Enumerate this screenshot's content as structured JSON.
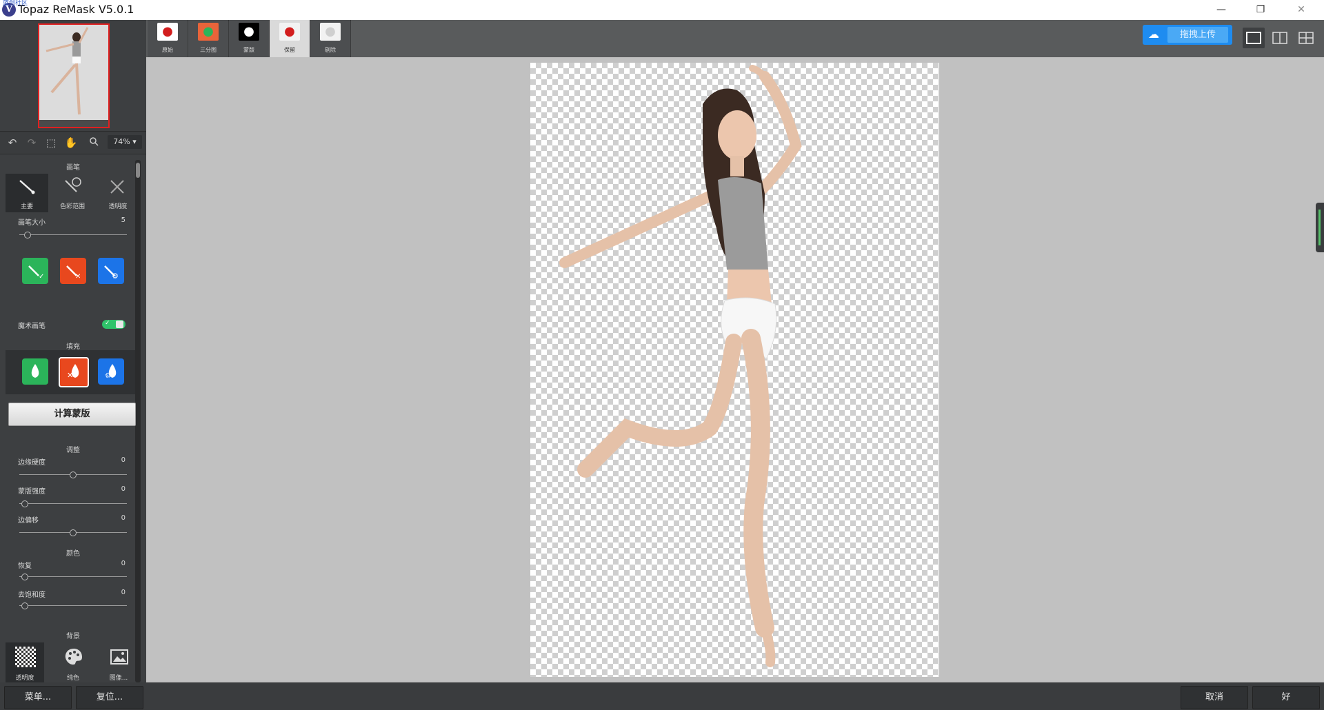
{
  "window": {
    "overlay_text": "蓝创社区",
    "title": "Topaz ReMask V5.0.1",
    "logo_letter": "V",
    "minimize": "—",
    "restore": "❐",
    "close": "✕"
  },
  "toolbar": {
    "zoom": "74% ▾"
  },
  "brush": {
    "section_title": "画笔",
    "modes": [
      {
        "label": "主要",
        "icon": "brush-icon"
      },
      {
        "label": "色彩范围",
        "icon": "color-range-brush-icon"
      },
      {
        "label": "透明度",
        "icon": "transparency-brush-icon"
      }
    ],
    "size_label": "画笔大小",
    "size_value": "5",
    "size_level": 0.08,
    "actions": [
      {
        "name": "keep",
        "icon": "keep-brush-icon",
        "color": "#2bb45a"
      },
      {
        "name": "drop",
        "icon": "drop-brush-icon",
        "color": "#e8481e"
      },
      {
        "name": "compute",
        "icon": "compute-brush-icon",
        "color": "#1c74e8"
      }
    ],
    "magic_label": "魔术画笔",
    "magic_on": true
  },
  "fill": {
    "section_title": "填充",
    "actions": [
      {
        "name": "keep",
        "icon": "keep-fill-icon",
        "color": "#2bb45a"
      },
      {
        "name": "drop",
        "icon": "drop-fill-icon",
        "color": "#e8481e"
      },
      {
        "name": "compute",
        "icon": "compute-fill-icon",
        "color": "#1c74e8"
      }
    ]
  },
  "compute_mask_label": "计算蒙版",
  "adjust": {
    "section_title": "调整",
    "sliders": [
      {
        "label": "边缘硬度",
        "value": "0",
        "level": 0.5
      },
      {
        "label": "蒙版强度",
        "value": "0",
        "level": 0.05
      },
      {
        "label": "边偏移",
        "value": "0",
        "level": 0.5
      }
    ]
  },
  "color": {
    "section_title": "颜色",
    "sliders": [
      {
        "label": "恢复",
        "value": "0",
        "level": 0.05
      },
      {
        "label": "去饱和度",
        "value": "0",
        "level": 0.05
      }
    ]
  },
  "background": {
    "section_title": "背景",
    "options": [
      {
        "label": "透明度",
        "icon": "checkerboard-icon"
      },
      {
        "label": "纯色",
        "icon": "palette-icon"
      },
      {
        "label": "图像...",
        "icon": "image-icon"
      }
    ]
  },
  "view_tabs": [
    {
      "label": "原始",
      "icon": "apple-original-icon",
      "thumb_bg": "#ffffff",
      "glyph_color": "#d21d1d"
    },
    {
      "label": "三分图",
      "icon": "apple-trimap-icon",
      "thumb_bg": "#e8643a",
      "glyph_color": "#2bb45a"
    },
    {
      "label": "蒙版",
      "icon": "apple-mask-icon",
      "thumb_bg": "#000000",
      "glyph_color": "#ffffff"
    },
    {
      "label": "保留",
      "icon": "apple-keep-icon",
      "thumb_bg": "#f2f2f2",
      "glyph_color": "#d21d1d"
    },
    {
      "label": "剔除",
      "icon": "apple-drop-icon",
      "thumb_bg": "#f2f2f2",
      "glyph_color": "#cfcfcf"
    }
  ],
  "upload": {
    "label": "拖拽上传"
  },
  "footer": {
    "menu": "菜单...",
    "reset": "复位...",
    "cancel": "取消",
    "ok": "好"
  }
}
